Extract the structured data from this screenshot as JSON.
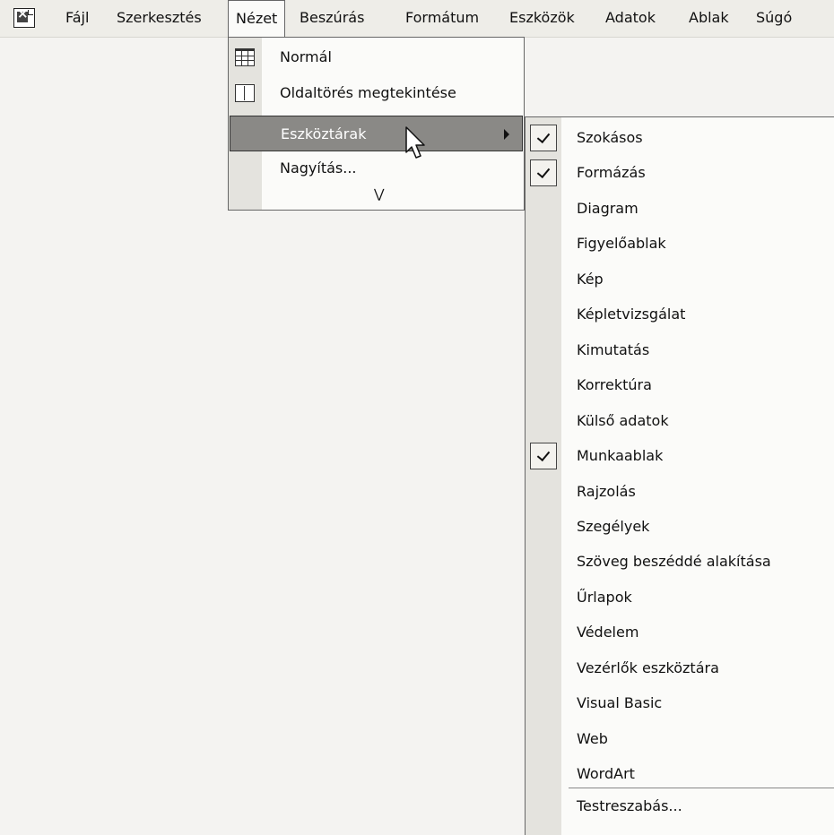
{
  "menubar": {
    "app_icon": "excel-app-icon",
    "items": [
      {
        "label": "Fájl",
        "mnemonic": "F"
      },
      {
        "label": "Szerkesztés",
        "mnemonic": "z"
      },
      {
        "label": "Nézet",
        "mnemonic": "N"
      },
      {
        "label": "Beszúrás",
        "mnemonic": "B"
      },
      {
        "label": "Formátum",
        "mnemonic": "t"
      },
      {
        "label": "Eszközök",
        "mnemonic": "E"
      },
      {
        "label": "Adatok",
        "mnemonic": "d"
      },
      {
        "label": "Ablak",
        "mnemonic": "A"
      },
      {
        "label": "Súgó",
        "mnemonic": "S"
      }
    ],
    "open_menu": "Nézet"
  },
  "view_menu": {
    "items": [
      {
        "label": "Normál",
        "icon": "normal-view-icon"
      },
      {
        "label": "Oldaltörés megtekintése",
        "icon": "page-break-preview-icon"
      },
      {
        "label": "Eszköztárak",
        "has_submenu": true,
        "highlighted": true
      },
      {
        "label": "Nagyítás..."
      }
    ],
    "expand_icon": "double-chevron-down-icon"
  },
  "toolbars_submenu": {
    "items": [
      {
        "label": "Szokásos",
        "checked": true
      },
      {
        "label": "Formázás",
        "checked": true
      },
      {
        "label": "Diagram",
        "checked": false
      },
      {
        "label": "Figyelőablak",
        "checked": false
      },
      {
        "label": "Kép",
        "checked": false
      },
      {
        "label": "Képletvizsgálat",
        "checked": false
      },
      {
        "label": "Kimutatás",
        "checked": false
      },
      {
        "label": "Korrektúra",
        "checked": false
      },
      {
        "label": "Külső adatok",
        "checked": false
      },
      {
        "label": "Munkaablak",
        "checked": true
      },
      {
        "label": "Rajzolás",
        "checked": false
      },
      {
        "label": "Szegélyek",
        "checked": false
      },
      {
        "label": "Szöveg beszéddé alakítása",
        "checked": false
      },
      {
        "label": "Űrlapok",
        "checked": false
      },
      {
        "label": "Védelem",
        "checked": false
      },
      {
        "label": "Vezérlők eszköztára",
        "checked": false
      },
      {
        "label": "Visual Basic",
        "checked": false
      },
      {
        "label": "Web",
        "checked": false
      },
      {
        "label": "WordArt",
        "checked": false
      }
    ],
    "customize_label": "Testreszabás..."
  }
}
